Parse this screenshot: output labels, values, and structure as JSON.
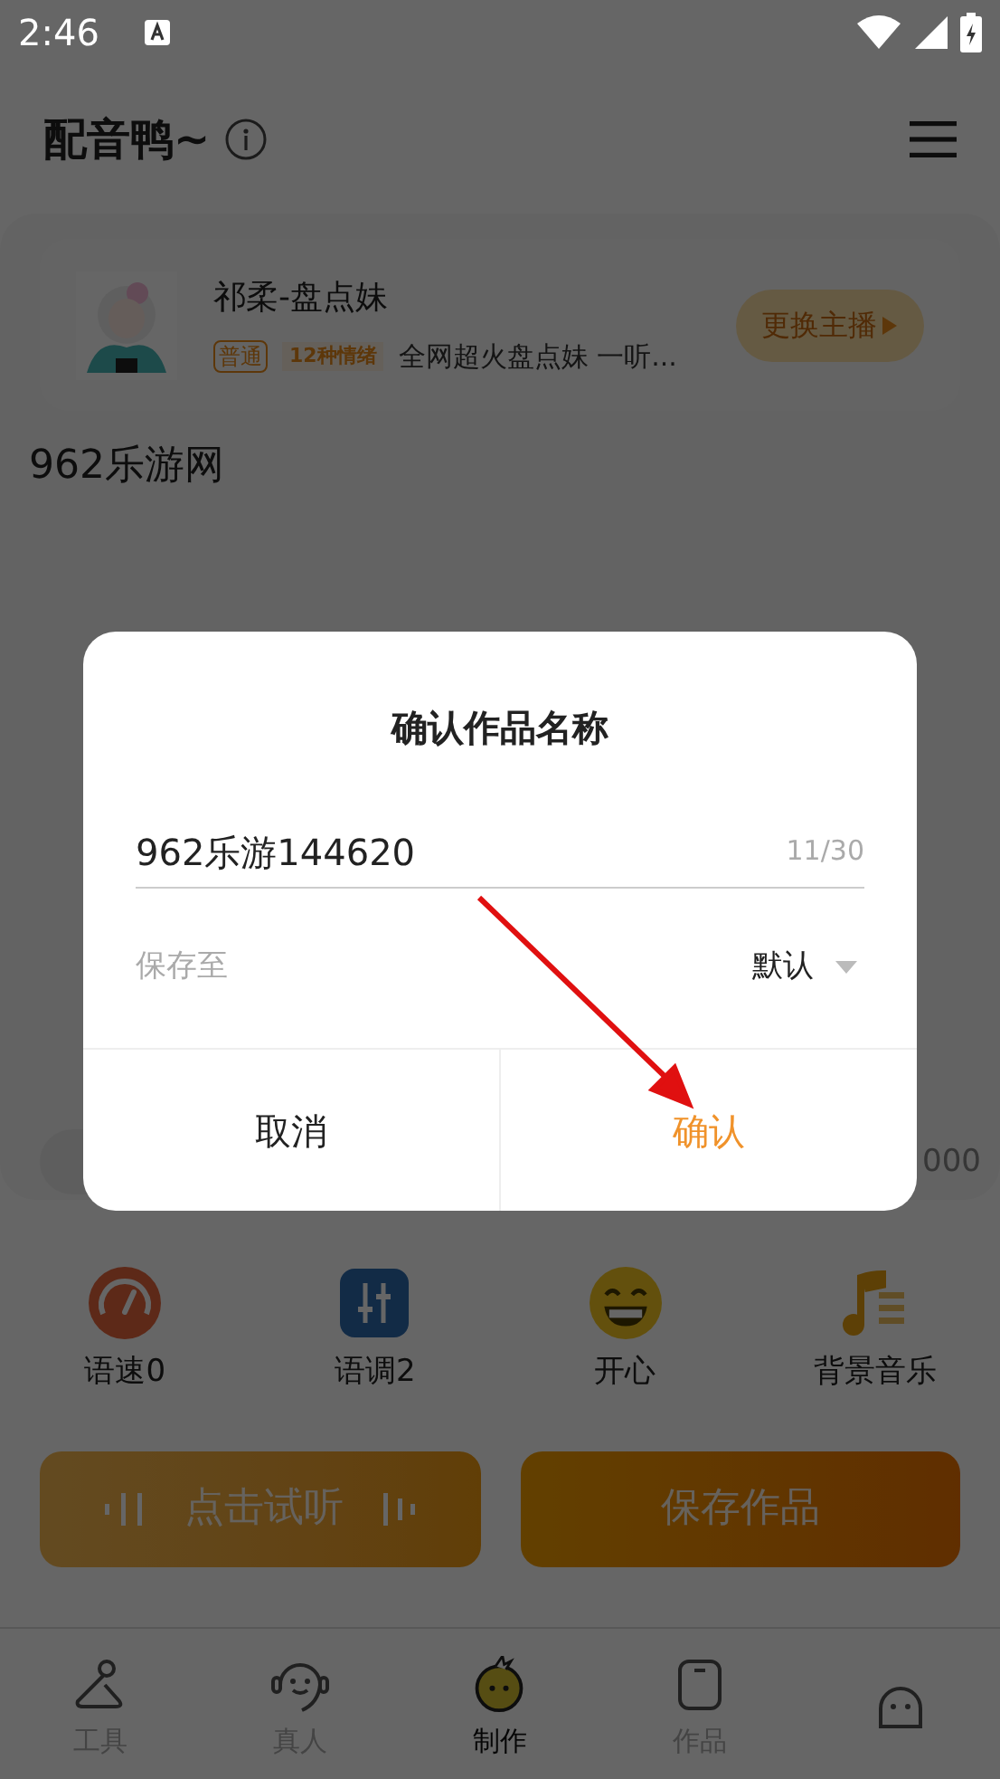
{
  "status_bar": {
    "time": "2:46"
  },
  "header": {
    "title": "配音鸭~"
  },
  "voice_card": {
    "name": "祁柔-盘点妹",
    "tags": [
      {
        "label": "普通",
        "kind": "outline"
      },
      {
        "label": "12种情绪",
        "kind": "filled"
      }
    ],
    "description": "全网超火盘点妹 一听...",
    "button": "更换主播"
  },
  "script_text": "962乐游网",
  "character_count": "000",
  "tools": [
    {
      "label": "语速0",
      "kind": "speed"
    },
    {
      "label": "语调2",
      "kind": "pitch"
    },
    {
      "label": "开心",
      "kind": "emotion"
    },
    {
      "label": "背景音乐",
      "kind": "music"
    }
  ],
  "actions": [
    {
      "label": "点击试听",
      "kind": "listen"
    },
    {
      "label": "保存作品",
      "kind": "save"
    }
  ],
  "tabs": [
    {
      "label": "工具",
      "kind": "tools",
      "selected": false
    },
    {
      "label": "真人",
      "kind": "human",
      "selected": false
    },
    {
      "label": "制作",
      "kind": "make",
      "selected": true
    },
    {
      "label": "作品",
      "kind": "works",
      "selected": false
    },
    {
      "kind": "me",
      "selected": false
    }
  ],
  "dialog": {
    "title": "确认作品名称",
    "name_value": "962乐游144620",
    "counter": "11/30",
    "save_label": "保存至",
    "save_value": "默认",
    "cancel": "取消",
    "confirm": "确认"
  }
}
